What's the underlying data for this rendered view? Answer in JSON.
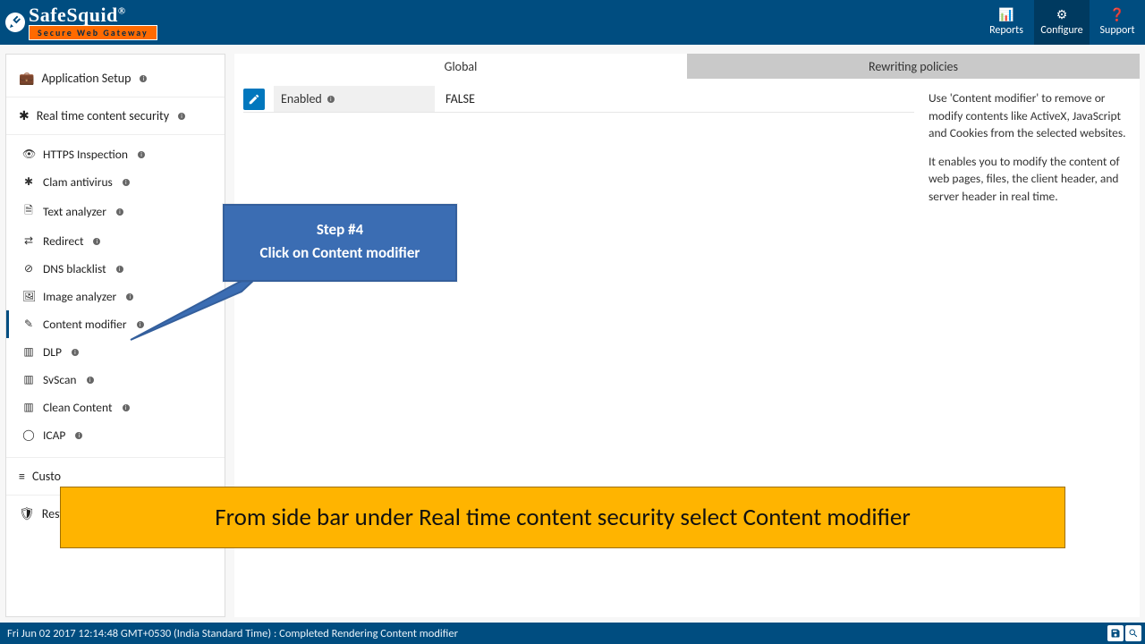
{
  "brand": {
    "name": "SafeSquid",
    "reg": "®",
    "tagline": "Secure Web Gateway"
  },
  "topnav": [
    {
      "key": "reports",
      "label": "Reports",
      "icon": "📊"
    },
    {
      "key": "configure",
      "label": "Configure",
      "icon": "⚙"
    },
    {
      "key": "support",
      "label": "Support",
      "icon": "❓"
    }
  ],
  "topnav_active": "configure",
  "sidebar": {
    "sections": [
      {
        "key": "app-setup",
        "label": "Application Setup",
        "icon": "💼"
      },
      {
        "key": "rtcs",
        "label": "Real time content security",
        "icon": "✱"
      }
    ],
    "items": [
      {
        "key": "https-inspection",
        "label": "HTTPS Inspection",
        "icon": "👁"
      },
      {
        "key": "clam-antivirus",
        "label": "Clam antivirus",
        "icon": "✱"
      },
      {
        "key": "text-analyzer",
        "label": "Text analyzer",
        "icon": "🗎"
      },
      {
        "key": "redirect",
        "label": "Redirect",
        "icon": "⇄"
      },
      {
        "key": "dns-blacklist",
        "label": "DNS blacklist",
        "icon": "⊘"
      },
      {
        "key": "image-analyzer",
        "label": "Image analyzer",
        "icon": "🖼"
      },
      {
        "key": "content-modifier",
        "label": "Content modifier",
        "icon": "✎"
      },
      {
        "key": "dlp",
        "label": "DLP",
        "icon": "▥"
      },
      {
        "key": "svscan",
        "label": "SvScan",
        "icon": "▥"
      },
      {
        "key": "clean-content",
        "label": "Clean Content",
        "icon": "▥"
      },
      {
        "key": "icap",
        "label": "ICAP",
        "icon": "◯"
      }
    ],
    "sections2": [
      {
        "key": "custom",
        "label": "Custom Settings",
        "icon": "≡"
      },
      {
        "key": "restrict",
        "label": "Restriction Profiles",
        "icon": "🛡"
      }
    ],
    "active_item": "content-modifier"
  },
  "tabs": [
    {
      "key": "global",
      "label": "Global"
    },
    {
      "key": "rewrite",
      "label": "Rewriting policies"
    }
  ],
  "tabs_active": "global",
  "props": {
    "enabled_label": "Enabled",
    "enabled_value": "FALSE"
  },
  "help": {
    "p1": "Use 'Content modifier' to remove or modify contents like ActiveX, JavaScript and Cookies from the selected websites.",
    "p2": "It enables you to modify the content of web pages, files, the client header, and server header in real time."
  },
  "callout": {
    "line1": "Step #4",
    "line2": "Click on Content modifier"
  },
  "banner": "From side bar under Real time content security select Content modifier",
  "status": {
    "text": "Fri Jun 02 2017 12:14:48 GMT+0530 (India Standard Time) : Completed Rendering Content modifier"
  }
}
